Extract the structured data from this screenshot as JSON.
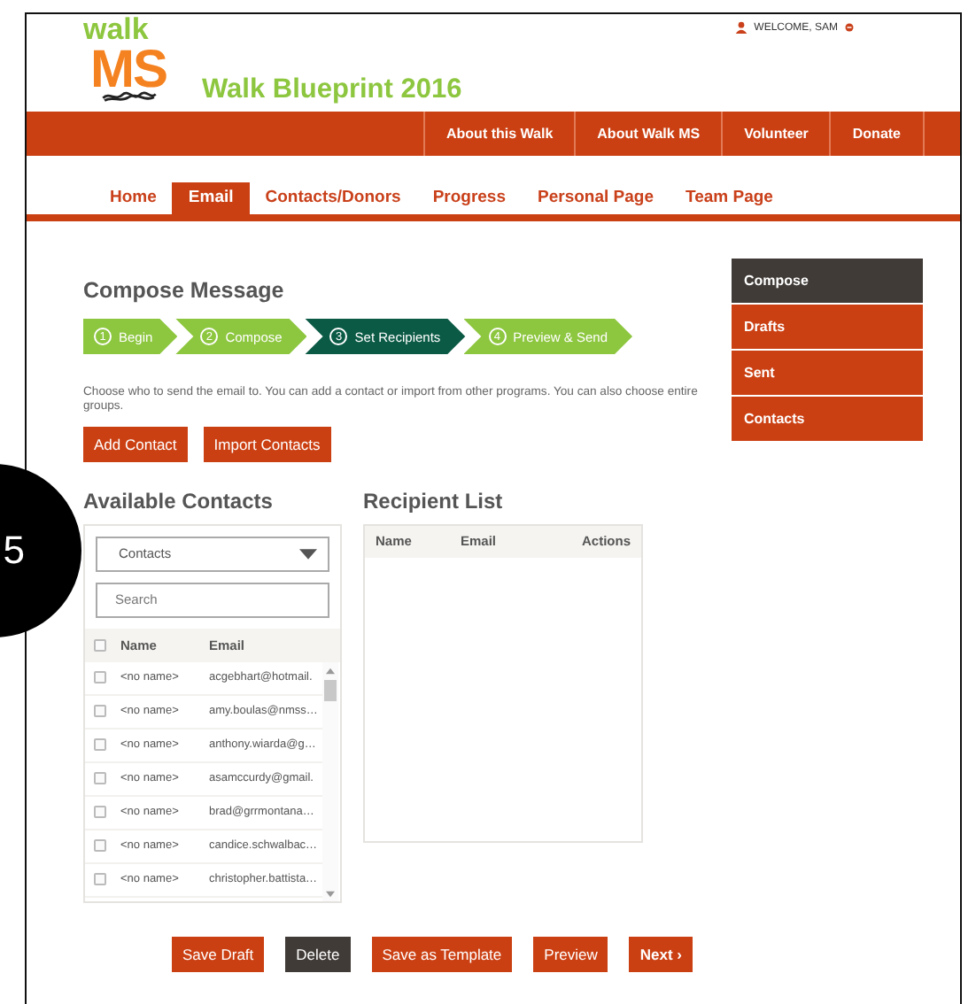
{
  "callout": {
    "number": "5"
  },
  "header": {
    "logo_top": "walk",
    "logo_bottom": "MS",
    "title": "Walk Blueprint 2016",
    "welcome": "WELCOME, SAM"
  },
  "top_nav": [
    {
      "label": "About this Walk"
    },
    {
      "label": "About Walk MS"
    },
    {
      "label": "Volunteer"
    },
    {
      "label": "Donate"
    }
  ],
  "tabs": [
    {
      "label": "Home",
      "selected": false
    },
    {
      "label": "Email",
      "selected": true
    },
    {
      "label": "Contacts/Donors",
      "selected": false
    },
    {
      "label": "Progress",
      "selected": false
    },
    {
      "label": "Personal Page",
      "selected": false
    },
    {
      "label": "Team Page",
      "selected": false
    }
  ],
  "heading": "Compose Message",
  "steps": [
    {
      "number": "1",
      "label": "Begin",
      "selected": false
    },
    {
      "number": "2",
      "label": "Compose",
      "selected": false
    },
    {
      "number": "3",
      "label": "Set Recipients",
      "selected": true
    },
    {
      "number": "4",
      "label": "Preview & Send",
      "selected": false
    }
  ],
  "description": "Choose who to send the email to. You can add a contact or import from other programs. You can also choose entire groups.",
  "action_buttons": [
    "Add Contact",
    "Import Contacts"
  ],
  "side_menu": [
    {
      "label": "Compose",
      "selected": true
    },
    {
      "label": "Drafts",
      "selected": false
    },
    {
      "label": "Sent",
      "selected": false
    },
    {
      "label": "Contacts",
      "selected": false
    }
  ],
  "available": {
    "title": "Available Contacts",
    "dropdown": "Contacts",
    "search_placeholder": "Search",
    "columns": [
      "Name",
      "Email"
    ],
    "select_all_checked": false,
    "rows": [
      {
        "name": "<no name>",
        "email": "acgebhart@hotmail.",
        "checked": false
      },
      {
        "name": "<no name>",
        "email": "amy.boulas@nmss…",
        "checked": false
      },
      {
        "name": "<no name>",
        "email": "anthony.wiarda@g…",
        "checked": false
      },
      {
        "name": "<no name>",
        "email": "asamccurdy@gmail.",
        "checked": false
      },
      {
        "name": "<no name>",
        "email": "brad@grrmontana…",
        "checked": false
      },
      {
        "name": "<no name>",
        "email": "candice.schwalbac…",
        "checked": false
      },
      {
        "name": "<no name>",
        "email": "christopher.battista…",
        "checked": false
      }
    ]
  },
  "recipients": {
    "title": "Recipient List",
    "columns": [
      "Name",
      "Email",
      "Actions"
    ]
  },
  "bottom_buttons": [
    {
      "label": "Save Draft",
      "kind": "primary"
    },
    {
      "label": "Delete",
      "kind": "dark"
    },
    {
      "label": "Save as Template",
      "kind": "primary"
    },
    {
      "label": "Preview",
      "kind": "primary"
    },
    {
      "label": "Next ›",
      "kind": "bold"
    }
  ]
}
